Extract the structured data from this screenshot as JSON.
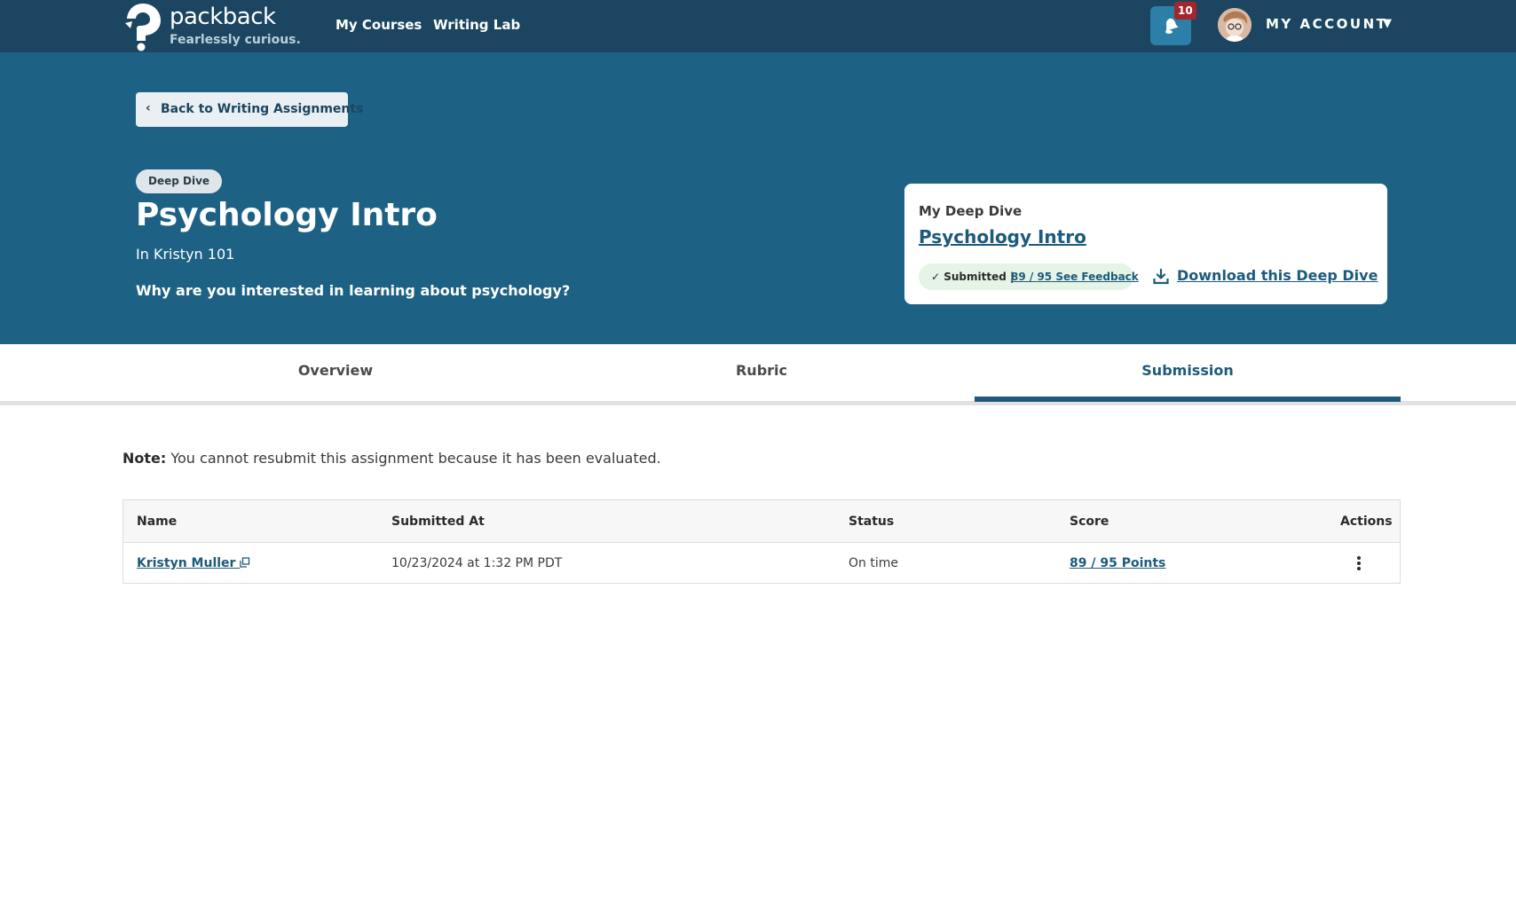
{
  "colors": {
    "nav_bg": "#1b4560",
    "hero_bg": "#1d6285",
    "accent": "#1d5a7c",
    "badge": "#a3262c",
    "status_bg": "#e5f4e6"
  },
  "brand": {
    "name": "packback",
    "tagline": "Fearlessly curious."
  },
  "nav": {
    "links": [
      "My Courses",
      "Writing Lab"
    ],
    "notification_count": "10",
    "account_label": "MY ACCOUNT",
    "account_caret": "▼"
  },
  "hero": {
    "back_prefix": "Back to ",
    "back_target": "Writing Assignments",
    "type": "Deep Dive",
    "title": "Psychology Intro",
    "course": "In Kristyn 101",
    "prompt": "Why are you interested in learning about psychology?"
  },
  "card": {
    "label": "My Deep Dive",
    "title": "Psychology Intro",
    "status": "✓ Submitted |",
    "feedback_link": "89 / 95 See Feedback",
    "download_label": "Download this Deep Dive"
  },
  "tabs": [
    {
      "label": "Overview",
      "active": false
    },
    {
      "label": "Rubric",
      "active": false
    },
    {
      "label": "Submission",
      "active": true
    }
  ],
  "note": {
    "label": "Note:",
    "text": " You cannot resubmit this assignment because it has been evaluated."
  },
  "table": {
    "headers": [
      "Name",
      "Submitted At",
      "Status",
      "Score",
      "Actions"
    ],
    "rows": [
      {
        "name": "Kristyn Muller",
        "submitted_at": "10/23/2024 at 1:32 PM PDT",
        "status": "On time",
        "score": "89 / 95 Points"
      }
    ]
  }
}
